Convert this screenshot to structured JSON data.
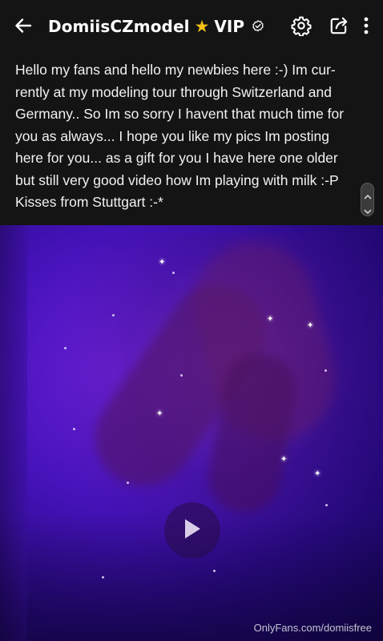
{
  "header": {
    "name": "DomiisCZmodel",
    "vip_label": "VIP",
    "icons": {
      "back": "arrow-left-icon",
      "star": "star-icon",
      "verified": "verified-check-icon",
      "settings": "gear-icon",
      "share": "share-icon",
      "more": "more-vertical-icon"
    }
  },
  "post": {
    "caption": "Hello my fans and hello my newbies here :-) Im cur-rently at my modeling tour through Switzerland and Germany.. So Im so sorry I havent that much time for you as always... I hope you like my pics Im posting here for you... as a gift for you I have here one older but still very good video how Im playing with milk :-P Kisses from Stuttgart :-*"
  },
  "media": {
    "type": "video",
    "watermark": "OnlyFans.com/domiisfree",
    "play_icon": "play-icon"
  },
  "colors": {
    "header_bg": "#141414",
    "star": "#f5c216",
    "media_purple": "#4512b8"
  }
}
